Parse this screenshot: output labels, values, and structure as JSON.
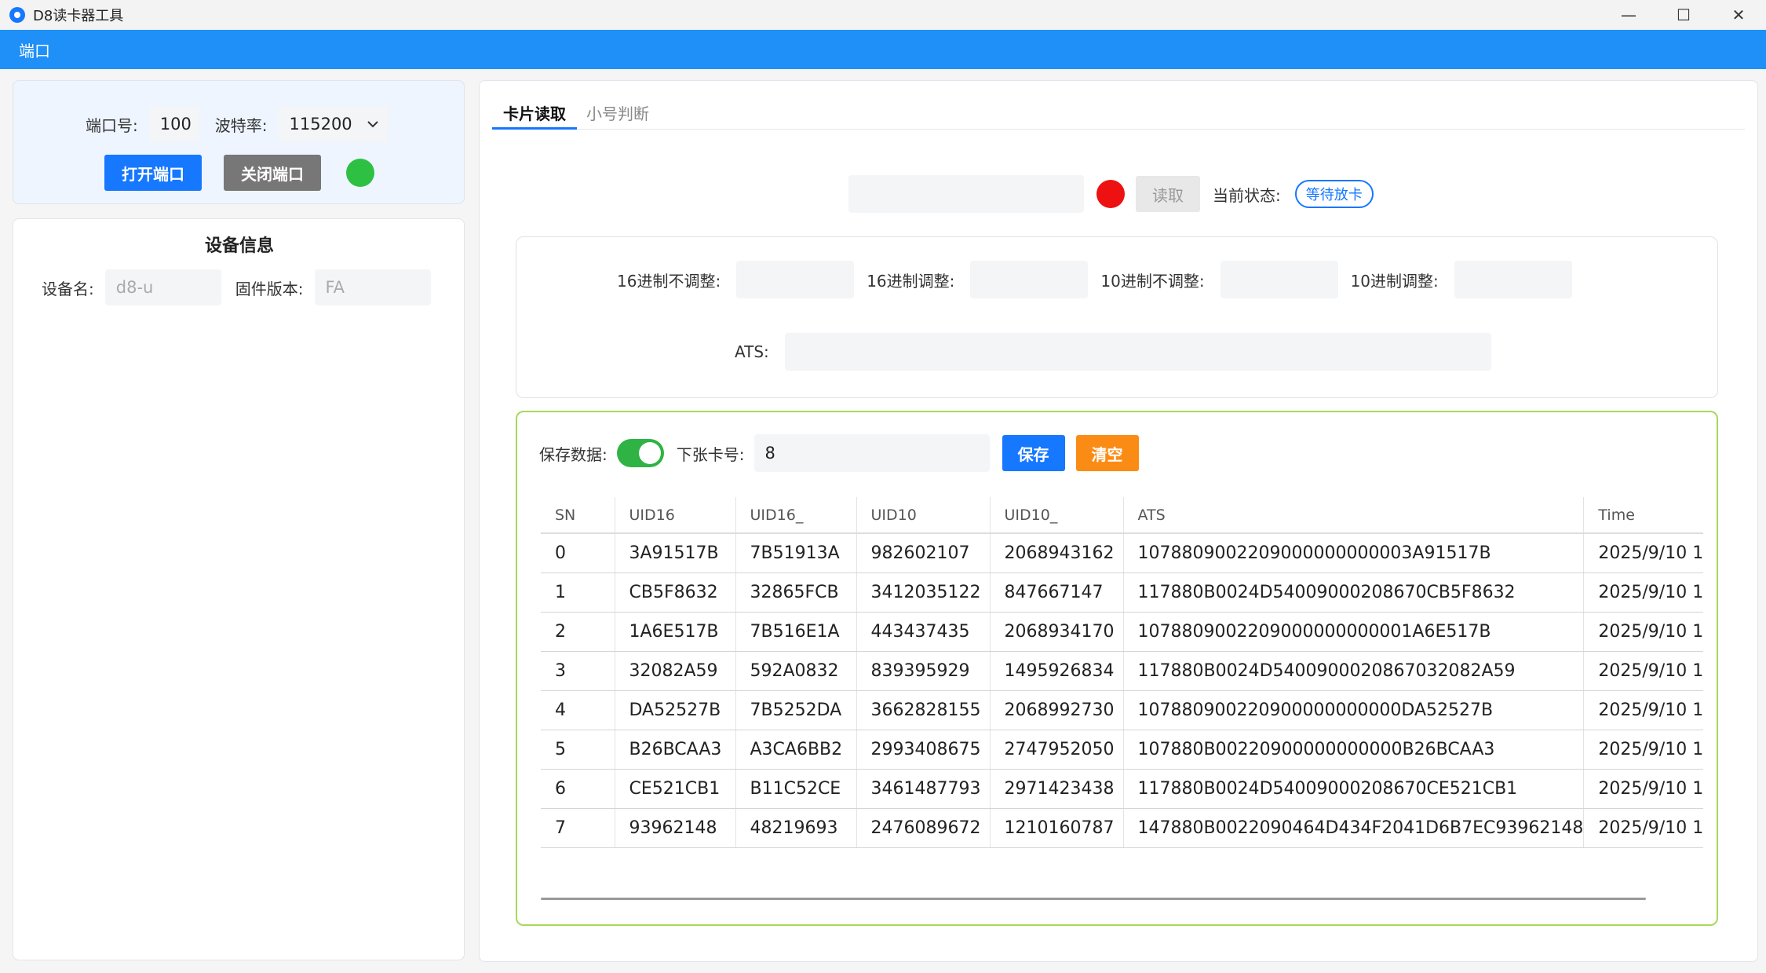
{
  "window": {
    "title": "D8读卡器工具",
    "minimize": "—",
    "maximize": "☐",
    "close": "✕"
  },
  "menu": {
    "port": "端口"
  },
  "port_panel": {
    "port_label": "端口号:",
    "port_value": "100",
    "baud_label": "波特率:",
    "baud_value": "115200",
    "open_label": "打开端口",
    "close_label": "关闭端口",
    "status_color": "#2ec043"
  },
  "device_panel": {
    "title": "设备信息",
    "name_label": "设备名:",
    "name_placeholder": "d8-u",
    "firmware_label": "固件版本:",
    "firmware_placeholder": "FA"
  },
  "tabs": {
    "card_read": "卡片读取",
    "small_check": "小号判断"
  },
  "reader": {
    "read_label": "读取",
    "state_label": "当前状态:",
    "state_value": "等待放卡",
    "indicator_color": "#ee1111"
  },
  "conversion": {
    "hex_raw_label": "16进制不调整:",
    "hex_adj_label": "16进制调整:",
    "dec_raw_label": "10进制不调整:",
    "dec_adj_label": "10进制调整:",
    "ats_label": "ATS:"
  },
  "data_section": {
    "save_data_label": "保存数据:",
    "save_data_on": true,
    "next_card_label": "下张卡号:",
    "next_card_value": "8",
    "save_label": "保存",
    "clear_label": "清空"
  },
  "table": {
    "columns": [
      "SN",
      "UID16",
      "UID16_",
      "UID10",
      "UID10_",
      "ATS",
      "Time"
    ],
    "rows": [
      [
        "0",
        "3A91517B",
        "7B51913A",
        "982602107",
        "2068943162",
        "1078809002209000000000003A91517B",
        "2025/9/10 1"
      ],
      [
        "1",
        "CB5F8632",
        "32865FCB",
        "3412035122",
        "847667147",
        "117880B0024D54009000208670CB5F8632",
        "2025/9/10 1"
      ],
      [
        "2",
        "1A6E517B",
        "7B516E1A",
        "443437435",
        "2068934170",
        "1078809002209000000000001A6E517B",
        "2025/9/10 1"
      ],
      [
        "3",
        "32082A59",
        "592A0832",
        "839395929",
        "1495926834",
        "117880B0024D5400900020867032082A59",
        "2025/9/10 1"
      ],
      [
        "4",
        "DA52527B",
        "7B5252DA",
        "3662828155",
        "2068992730",
        "107880900220900000000000DA52527B",
        "2025/9/10 1"
      ],
      [
        "5",
        "B26BCAA3",
        "A3CA6BB2",
        "2993408675",
        "2747952050",
        "107880B00220900000000000B26BCAA3",
        "2025/9/10 1"
      ],
      [
        "6",
        "CE521CB1",
        "B11C52CE",
        "3461487793",
        "2971423438",
        "117880B0024D54009000208670CE521CB1",
        "2025/9/10 1"
      ],
      [
        "7",
        "93962148",
        "48219693",
        "2476089672",
        "1210160787",
        "147880B0022090464D434F2041D6B7EC93962148",
        "2025/9/10 1"
      ]
    ]
  }
}
